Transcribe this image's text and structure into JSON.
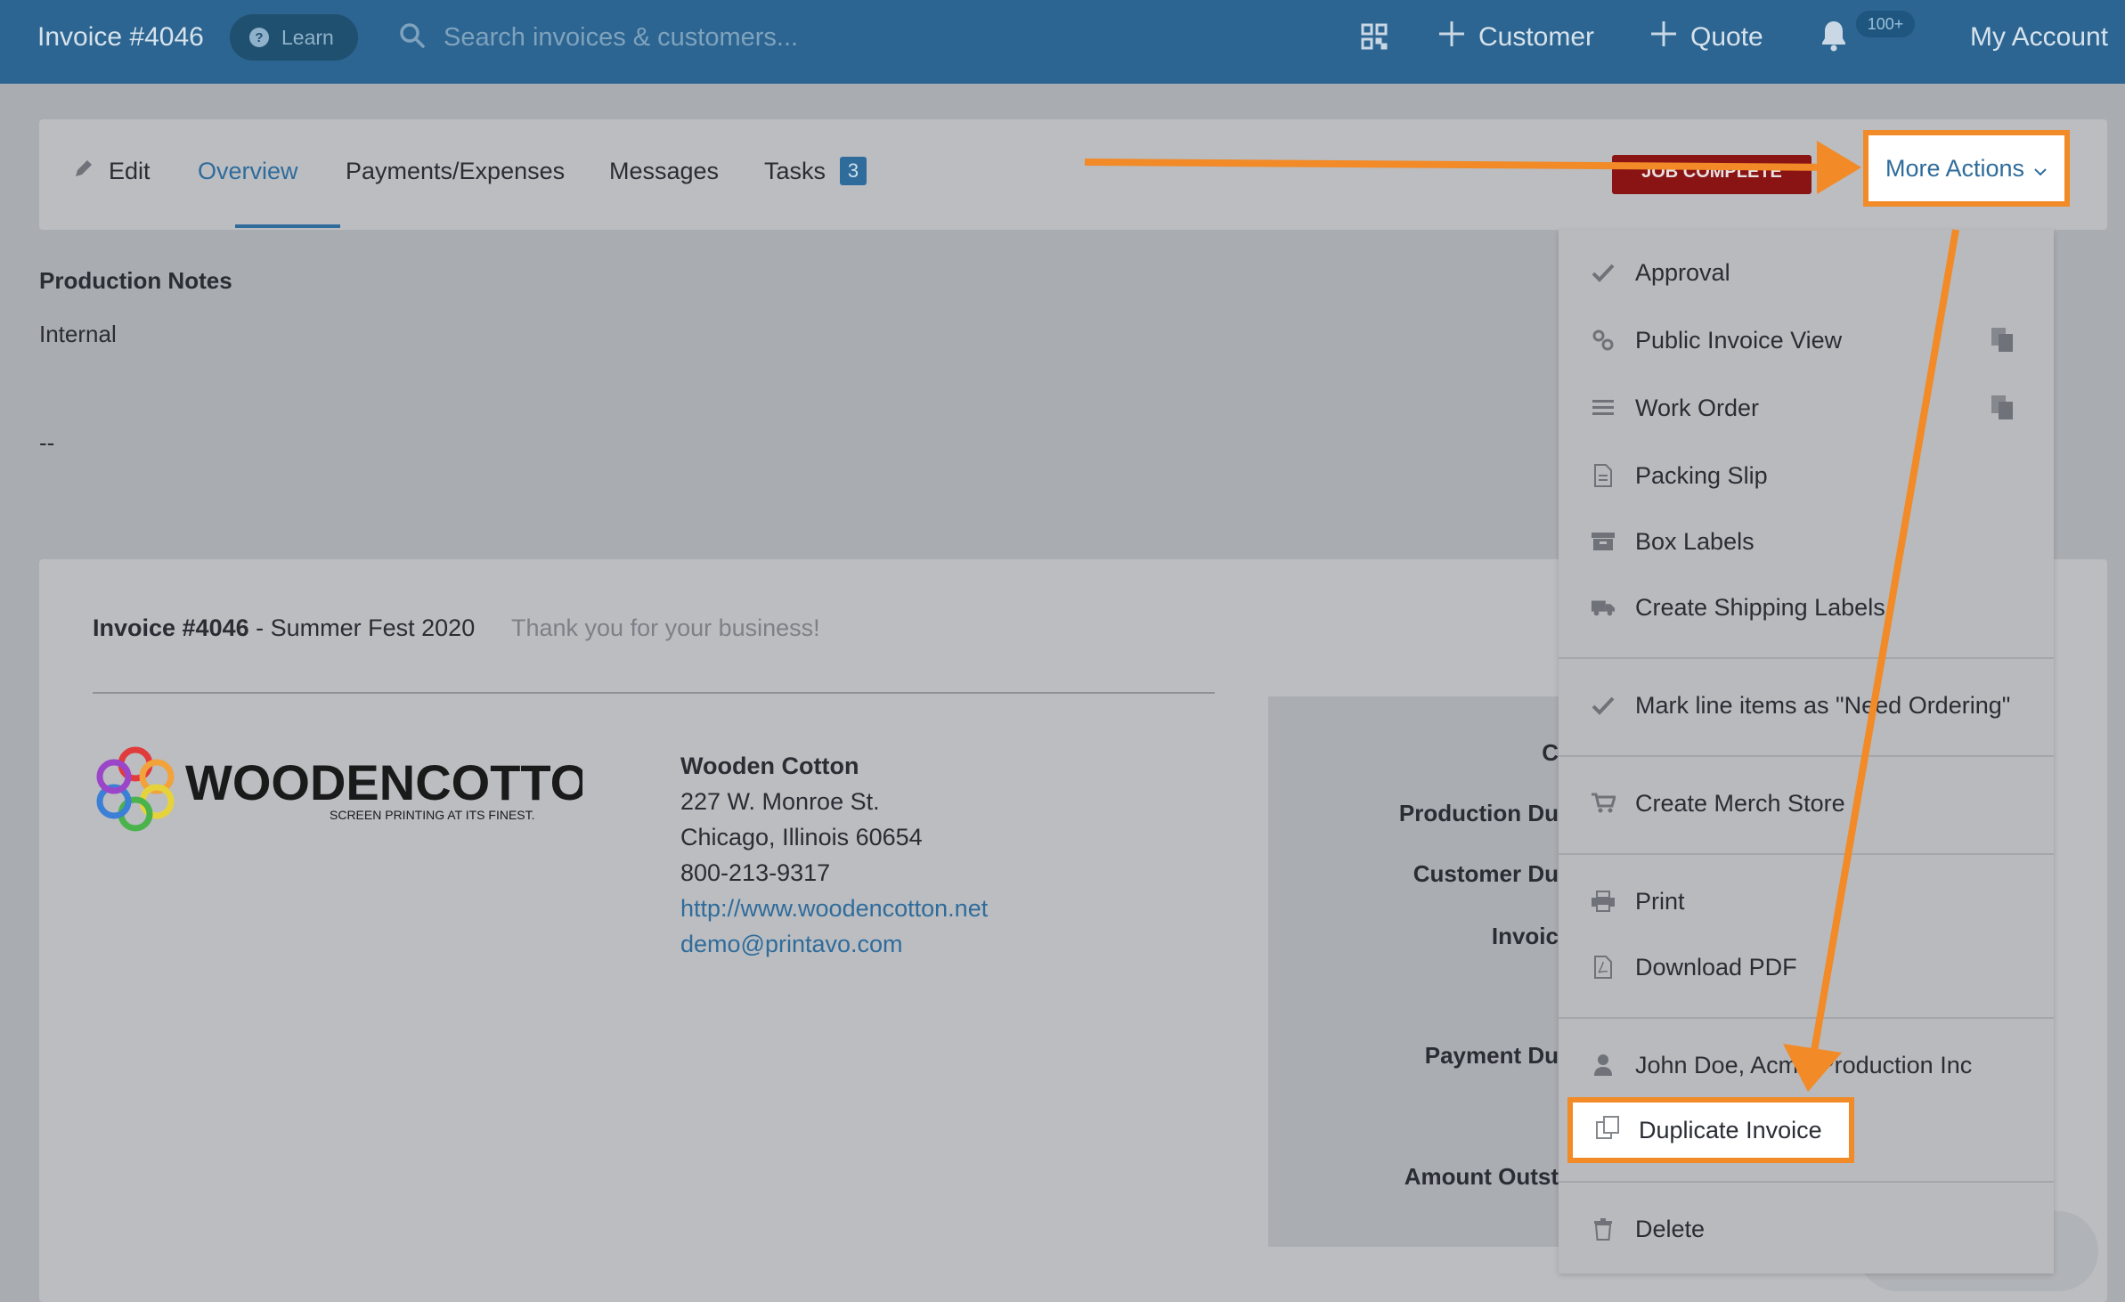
{
  "topbar": {
    "title": "Invoice #4046",
    "learn_label": "Learn",
    "search_placeholder": "Search invoices & customers...",
    "customer_label": "Customer",
    "quote_label": "Quote",
    "notification_count": "100+",
    "account_label": "My Account"
  },
  "tabs": {
    "edit": "Edit",
    "overview": "Overview",
    "payments": "Payments/Expenses",
    "messages": "Messages",
    "tasks": "Tasks",
    "tasks_count": "3",
    "status_badge": "JOB COMPLETE",
    "more_actions": "More Actions"
  },
  "notes": {
    "title": "Production Notes",
    "label": "Internal",
    "value": "--"
  },
  "invoice": {
    "number": "Invoice #4046",
    "name": " - Summer Fest 2020",
    "thanks": "Thank you for your business!",
    "logo_text": "WOODENCOTTON",
    "logo_tagline": "SCREEN PRINTING AT ITS FINEST.",
    "company": {
      "name": "Wooden Cotton",
      "street": "227 W. Monroe St.",
      "city": "Chicago, Illinois 60654",
      "phone": "800-213-9317",
      "website": "http://www.woodencotton.net",
      "email": "demo@printavo.com"
    },
    "summary_labels": [
      "C",
      "Production Du",
      "Customer Du",
      "Invoic",
      "Payment Du",
      "Amount Outst"
    ]
  },
  "menu": {
    "approval": "Approval",
    "public_view": "Public Invoice View",
    "work_order": "Work Order",
    "packing_slip": "Packing Slip",
    "box_labels": "Box Labels",
    "shipping_labels": "Create Shipping Labels",
    "mark_need_ordering": "Mark line items as \"Need Ordering\"",
    "merch_store": "Create Merch Store",
    "print": "Print",
    "download_pdf": "Download PDF",
    "customer_contact": "John Doe, Acme Production Inc",
    "duplicate": "Duplicate Invoice",
    "delete": "Delete"
  },
  "colors": {
    "nav": "#2c6591",
    "accent": "#2f6c9b",
    "highlight": "#f28a27",
    "status_red": "#8a1414"
  }
}
